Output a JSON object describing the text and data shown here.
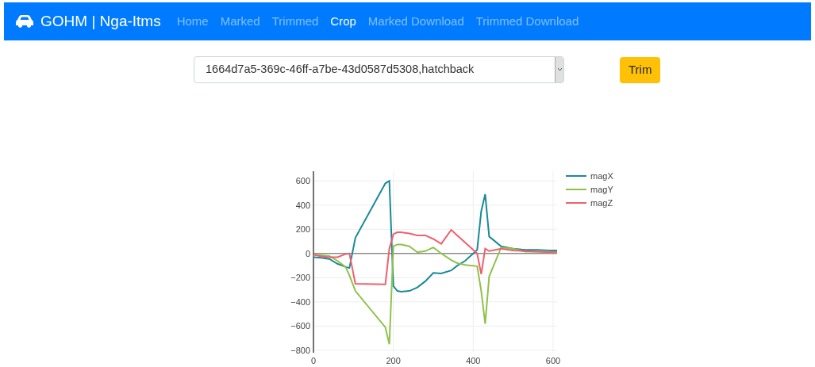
{
  "navbar": {
    "brand": "GOHM | Nga-Itms",
    "links": [
      {
        "label": "Home",
        "selected": false
      },
      {
        "label": "Marked",
        "selected": false
      },
      {
        "label": "Trimmed",
        "selected": false
      },
      {
        "label": "Crop",
        "selected": true
      },
      {
        "label": "Marked Download",
        "selected": false
      },
      {
        "label": "Trimmed Download",
        "selected": false
      }
    ]
  },
  "select": {
    "value": "1664d7a5-369c-46ff-a7be-43d0587d5308,hatchback"
  },
  "trim_button": "Trim",
  "chart_data": {
    "type": "line",
    "x": [
      0,
      20,
      40,
      60,
      80,
      90,
      105,
      180,
      190,
      200,
      210,
      220,
      240,
      260,
      280,
      300,
      320,
      345,
      360,
      380,
      410,
      420,
      430,
      440,
      470,
      500,
      530,
      560,
      590,
      610
    ],
    "series": [
      {
        "name": "magX",
        "color": "#1a8a96",
        "values": [
          -30,
          -35,
          -45,
          -85,
          -110,
          -120,
          130,
          580,
          600,
          -270,
          -310,
          -315,
          -310,
          -280,
          -230,
          -160,
          -165,
          -140,
          -100,
          -60,
          30,
          350,
          490,
          140,
          60,
          40,
          30,
          30,
          25,
          25
        ]
      },
      {
        "name": "magY",
        "color": "#8fc24a",
        "values": [
          -10,
          -15,
          -20,
          -60,
          -110,
          -180,
          -310,
          -610,
          -750,
          60,
          75,
          75,
          60,
          10,
          20,
          50,
          0,
          -55,
          -80,
          -95,
          -105,
          -310,
          -580,
          -190,
          50,
          40,
          15,
          15,
          15,
          10
        ]
      },
      {
        "name": "magZ",
        "color": "#f0606e",
        "values": [
          -10,
          -25,
          -30,
          -30,
          -5,
          0,
          -250,
          -255,
          40,
          160,
          175,
          175,
          165,
          150,
          150,
          120,
          80,
          195,
          150,
          90,
          0,
          -170,
          40,
          20,
          40,
          25,
          20,
          15,
          10,
          15
        ]
      }
    ],
    "grid": true,
    "legend": true,
    "xlim": [
      0,
      610
    ],
    "ylim": [
      -820,
      680
    ],
    "xticks": [
      0,
      200,
      400,
      600
    ],
    "yticks": [
      -800,
      -600,
      -400,
      -200,
      0,
      200,
      400,
      600
    ]
  }
}
